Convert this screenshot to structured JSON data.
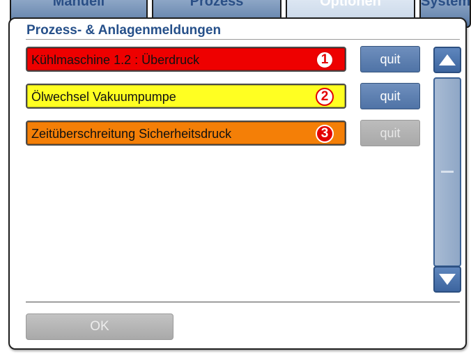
{
  "background_tabs": [
    {
      "label": "Manuell"
    },
    {
      "label": "Prozess"
    },
    {
      "label": "Optionen"
    },
    {
      "label": "System"
    }
  ],
  "dialog": {
    "title": "Prozess- & Anlagenmeldungen",
    "messages": [
      {
        "text": "Kühlmaschine 1.2 : Überdruck",
        "number": "1",
        "color": "#ee0000",
        "quit_label": "quit",
        "quit_enabled": true
      },
      {
        "text": "Ölwechsel Vakuumpumpe",
        "number": "2",
        "color": "#ffff22",
        "quit_label": "quit",
        "quit_enabled": true
      },
      {
        "text": "Zeitüberschreitung Sicherheitsdruck",
        "number": "3",
        "color": "#f47f07",
        "quit_label": "quit",
        "quit_enabled": false
      }
    ],
    "ok_label": "OK",
    "ok_enabled": false
  },
  "colors": {
    "title": "#26508a",
    "button_blue": "#5a7db0",
    "button_disabled": "#b0b0b0"
  }
}
